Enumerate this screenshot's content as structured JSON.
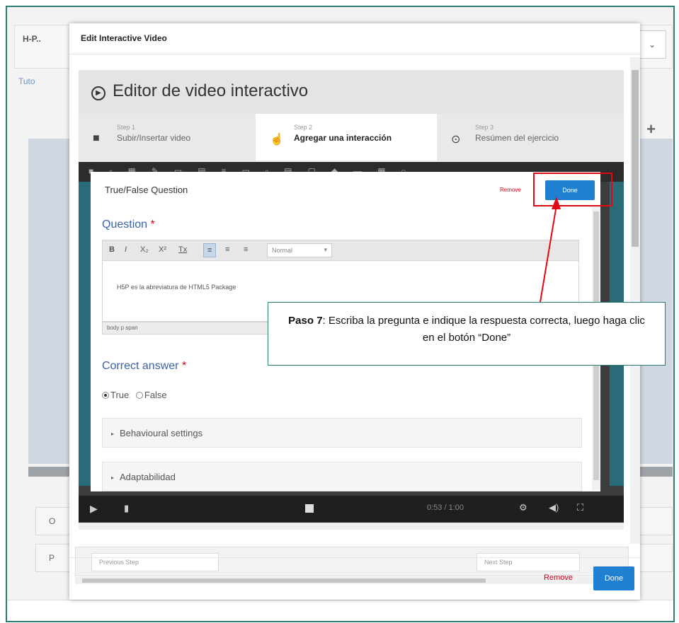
{
  "background": {
    "tag": "H-P..",
    "dropdown_icon": "chevron-down-icon",
    "link": "Tuto",
    "plus": "+",
    "rows": [
      "O",
      "P"
    ]
  },
  "modal": {
    "title": "Edit Interactive Video",
    "footer": {
      "remove": "Remove",
      "done": "Done"
    }
  },
  "editor": {
    "title": "Editor de video interactivo",
    "steps": [
      {
        "kicker": "Step 1",
        "label": "Subir/Insertar video",
        "icon": "video-camera-icon"
      },
      {
        "kicker": "Step 2",
        "label": "Agregar una interacción",
        "icon": "hand-pointer-icon"
      },
      {
        "kicker": "Step 3",
        "label": "Resúmen del ejercicio",
        "icon": "check-circle-icon"
      }
    ],
    "player": {
      "time": "0:53 / 1:00"
    },
    "bottom": {
      "prev": "Previous Step",
      "next": "Next Step"
    }
  },
  "dialog": {
    "title": "True/False Question",
    "remove": "Remove",
    "done": "Done",
    "question_label": "Question",
    "required_mark": "*",
    "toolbar": {
      "bold": "B",
      "italic": "I",
      "sub": "X₂",
      "sup": "X²",
      "clear": "Tx",
      "format": "Normal"
    },
    "question_text": "H5P es la abreviatura de HTML5 Package",
    "path": "body  p  span",
    "correct_label": "Correct answer",
    "options": [
      "True",
      "False"
    ],
    "selected": "True",
    "sections": [
      "Behavioural settings",
      "Adaptabilidad"
    ]
  },
  "annotation": {
    "step": "Paso 7",
    "text": ": Escriba la pregunta e indique la respuesta correcta, luego haga clic en el botón “Done”",
    "color": "#e30613"
  }
}
